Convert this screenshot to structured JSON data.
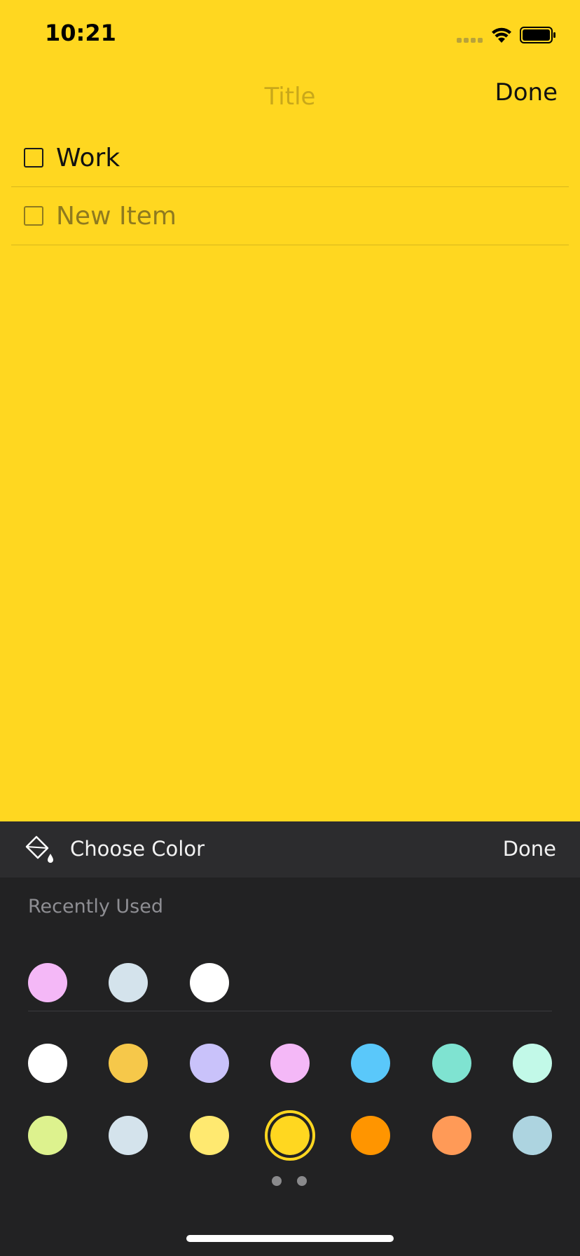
{
  "status_bar": {
    "time": "10:21"
  },
  "nav": {
    "title": "Title",
    "done_label": "Done"
  },
  "items": [
    {
      "label": "Work"
    },
    {
      "label": "New Item"
    }
  ],
  "color_panel": {
    "title": "Choose Color",
    "done_label": "Done",
    "recently_used_label": "Recently Used",
    "recently_used": [
      "#F4B8F7",
      "#D4E3EC",
      "#FFFFFF"
    ],
    "palette_row_1": [
      "#FFFFFF",
      "#F6C84A",
      "#C9C2FA",
      "#F4B8F7",
      "#5AC8FA",
      "#7FE3D1",
      "#C2F9E8"
    ],
    "palette_row_2": [
      "#DDF28E",
      "#D4E3EC",
      "#FFE970",
      "#FFD720",
      "#FF9500",
      "#FF9A57",
      "#ADD4E0"
    ],
    "selected_color": "#FFD720",
    "page_count": 2,
    "current_page": 1
  },
  "colors": {
    "background": "#FFD720",
    "panel": "#222223",
    "panel_header": "#2C2C2E"
  },
  "icons": {
    "paint_bucket": "paint-bucket-icon",
    "wifi": "wifi-icon",
    "battery": "battery-icon",
    "signal": "signal-icon"
  }
}
